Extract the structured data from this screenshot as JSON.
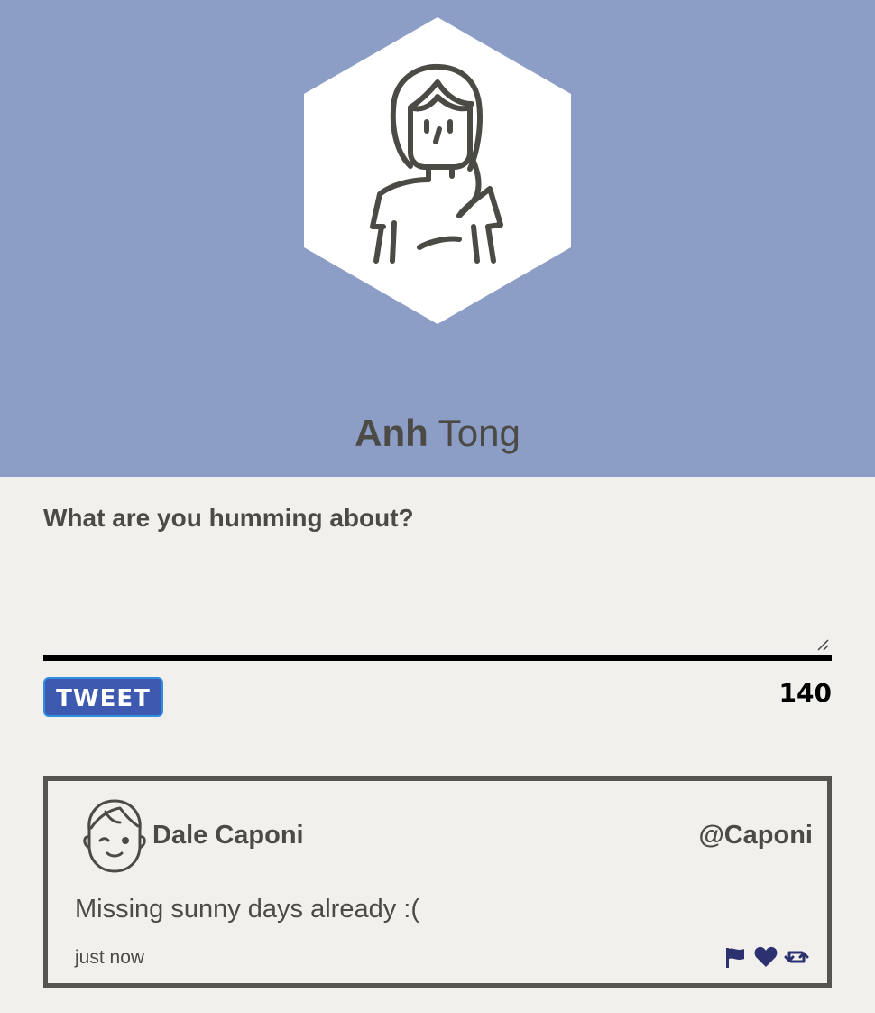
{
  "profile": {
    "first_name": "Anh",
    "last_name": "Tong",
    "avatar_icon": "woman-avatar-icon",
    "header_color": "#8c9dc6"
  },
  "composer": {
    "prompt_label": "What are you humming about?",
    "textarea_value": "",
    "tweet_button_label": "TWEET",
    "char_count": "140"
  },
  "tweets": [
    {
      "avatar_icon": "man-winking-avatar-icon",
      "author": "Dale Caponi",
      "handle": "@Caponi",
      "text": "Missing sunny days already :(",
      "time": "just now",
      "actions": [
        "flag-icon",
        "heart-icon",
        "retweet-icon"
      ]
    }
  ],
  "colors": {
    "accent": "#3d5ab0",
    "icon_navy": "#2c3270",
    "page_bg": "#f1f0ec"
  }
}
